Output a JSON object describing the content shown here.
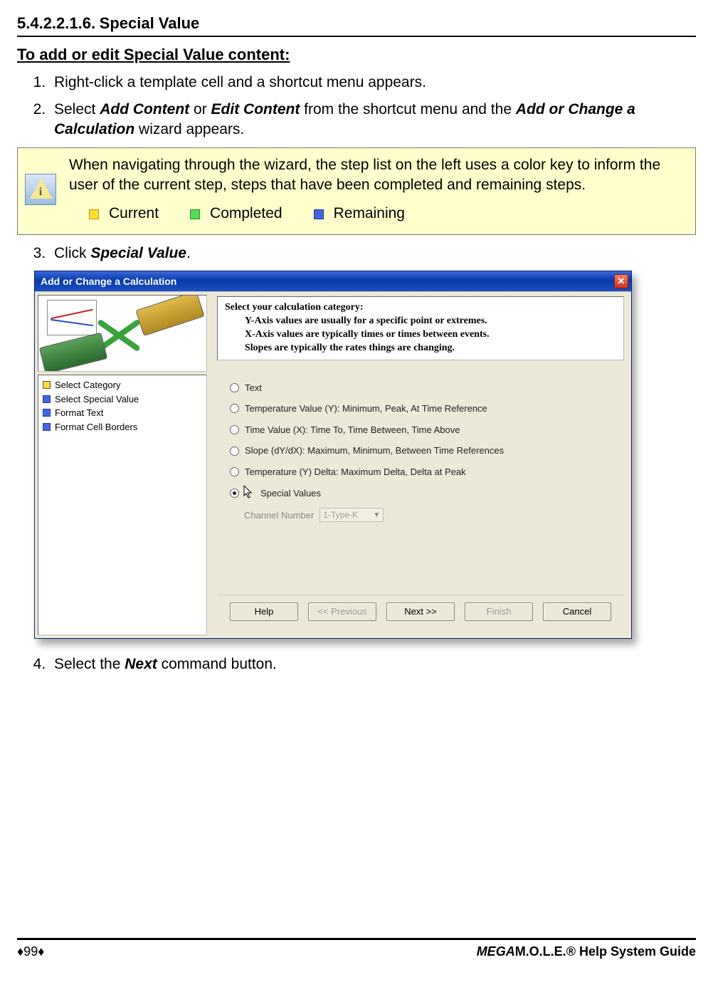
{
  "section": {
    "number": "5.4.2.2.1.6.",
    "title": "Special Value"
  },
  "subhead": "To add or edit Special Value content:",
  "steps": {
    "s1": "Right-click a template cell and a shortcut menu appears.",
    "s2a": "Select ",
    "s2b": "Add Content",
    "s2c": " or ",
    "s2d": "Edit Content",
    "s2e": " from the shortcut menu and the ",
    "s2f": "Add or Change a Calculation",
    "s2g": " wizard appears.",
    "s3a": "Click ",
    "s3b": "Special Value",
    "s3c": ".",
    "s4a": "Select the ",
    "s4b": "Next",
    "s4c": " command button."
  },
  "note": {
    "text": "When navigating through the wizard, the step list on the left uses a color key to inform the user of the current step, steps that have been completed and remaining steps.",
    "legend": {
      "current": "Current",
      "completed": "Completed",
      "remaining": "Remaining"
    }
  },
  "wizard": {
    "title": "Add or Change a Calculation",
    "stepsList": [
      {
        "color": "y",
        "label": "Select Category"
      },
      {
        "color": "b",
        "label": "Select Special Value"
      },
      {
        "color": "b",
        "label": "Format Text"
      },
      {
        "color": "b",
        "label": "Format Cell Borders"
      }
    ],
    "promptTitle": "Select your calculation category:",
    "promptL1": "Y-Axis values are usually for a specific point or extremes.",
    "promptL2": "X-Axis values are typically times or times between events.",
    "promptL3": "Slopes are typically the rates things are changing.",
    "options": {
      "o1": "Text",
      "o2": "Temperature Value (Y):  Minimum, Peak, At Time Reference",
      "o3": "Time Value (X):  Time To, Time Between, Time Above",
      "o4": "Slope (dY/dX):  Maximum, Minimum, Between Time References",
      "o5": "Temperature (Y) Delta:  Maximum Delta, Delta at Peak",
      "o6": "Special  Values"
    },
    "channelLabel": "Channel Number",
    "channelValue": "1-Type-K",
    "buttons": {
      "help": "Help",
      "prev": "<< Previous",
      "next": "Next >>",
      "finish": "Finish",
      "cancel": "Cancel"
    }
  },
  "footer": {
    "page": "♦99♦",
    "guidePrefix": "MEGA",
    "guideRest": "M.O.L.E.® Help System Guide"
  }
}
